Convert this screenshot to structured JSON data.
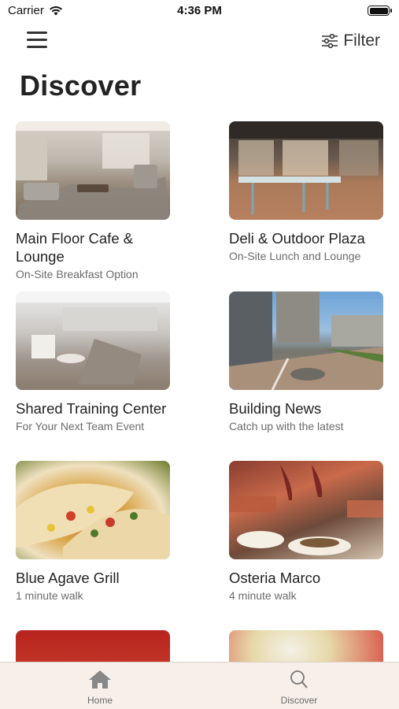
{
  "status": {
    "carrier": "Carrier",
    "time": "4:36 PM"
  },
  "nav": {
    "filter_label": "Filter"
  },
  "page_title": "Discover",
  "cards": [
    {
      "title": "Main Floor Cafe & Lounge",
      "subtitle": "On-Site Breakfast Option"
    },
    {
      "title": "Deli & Outdoor Plaza",
      "subtitle": "On-Site Lunch and Lounge"
    },
    {
      "title": "Shared Training Center",
      "subtitle": "For Your Next Team Event"
    },
    {
      "title": "Building News",
      "subtitle": "Catch up with the latest"
    },
    {
      "title": "Blue Agave Grill",
      "subtitle": "1 minute walk"
    },
    {
      "title": "Osteria Marco",
      "subtitle": "4 minute walk"
    }
  ],
  "tabs": [
    {
      "label": "Home",
      "icon": "home-icon"
    },
    {
      "label": "Discover",
      "icon": "search-icon"
    }
  ],
  "colors": {
    "tab_bar_bg": "#f6efea",
    "text_primary": "#222222",
    "text_secondary": "#6b6b6b"
  }
}
